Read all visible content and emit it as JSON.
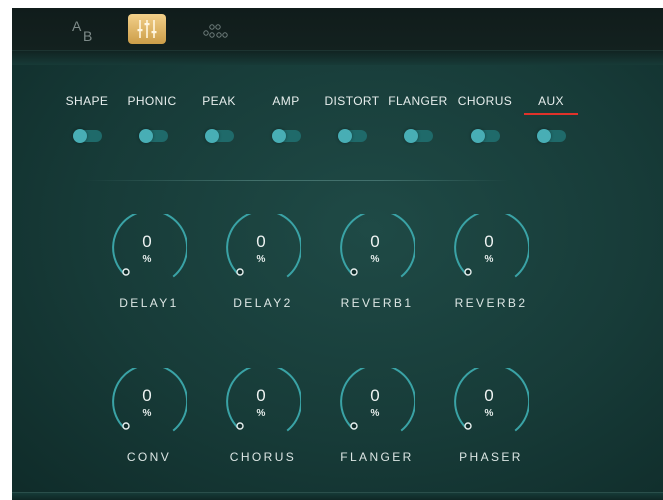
{
  "topbar": {
    "ab_icon": {
      "a": "A",
      "b": "B",
      "icon": "ab-compare-icon"
    },
    "mixer_icon": "mixer-sliders-icon",
    "dots_icon": "nodes-icon"
  },
  "tabs": [
    {
      "label": "SHAPE",
      "active": false
    },
    {
      "label": "PHONIC",
      "active": false
    },
    {
      "label": "PEAK",
      "active": false
    },
    {
      "label": "AMP",
      "active": false
    },
    {
      "label": "DISTORT",
      "active": false
    },
    {
      "label": "FLANGER",
      "active": false
    },
    {
      "label": "CHORUS",
      "active": false
    },
    {
      "label": "AUX",
      "active": true
    }
  ],
  "toggles": [
    false,
    false,
    false,
    false,
    false,
    false,
    false,
    false
  ],
  "knobs": [
    {
      "value": "0",
      "unit": "%",
      "label": "DELAY1"
    },
    {
      "value": "0",
      "unit": "%",
      "label": "DELAY2"
    },
    {
      "value": "0",
      "unit": "%",
      "label": "REVERB1"
    },
    {
      "value": "0",
      "unit": "%",
      "label": "REVERB2"
    },
    {
      "value": "0",
      "unit": "%",
      "label": "CONV"
    },
    {
      "value": "0",
      "unit": "%",
      "label": "CHORUS"
    },
    {
      "value": "0",
      "unit": "%",
      "label": "FLANGER"
    },
    {
      "value": "0",
      "unit": "%",
      "label": "PHASER"
    }
  ],
  "colors": {
    "accent_underline": "#e0322a",
    "knob_ring": "#3aa3a6",
    "toggle_knob": "#48aeb5",
    "mixer_gold": "#d9ad5c"
  }
}
